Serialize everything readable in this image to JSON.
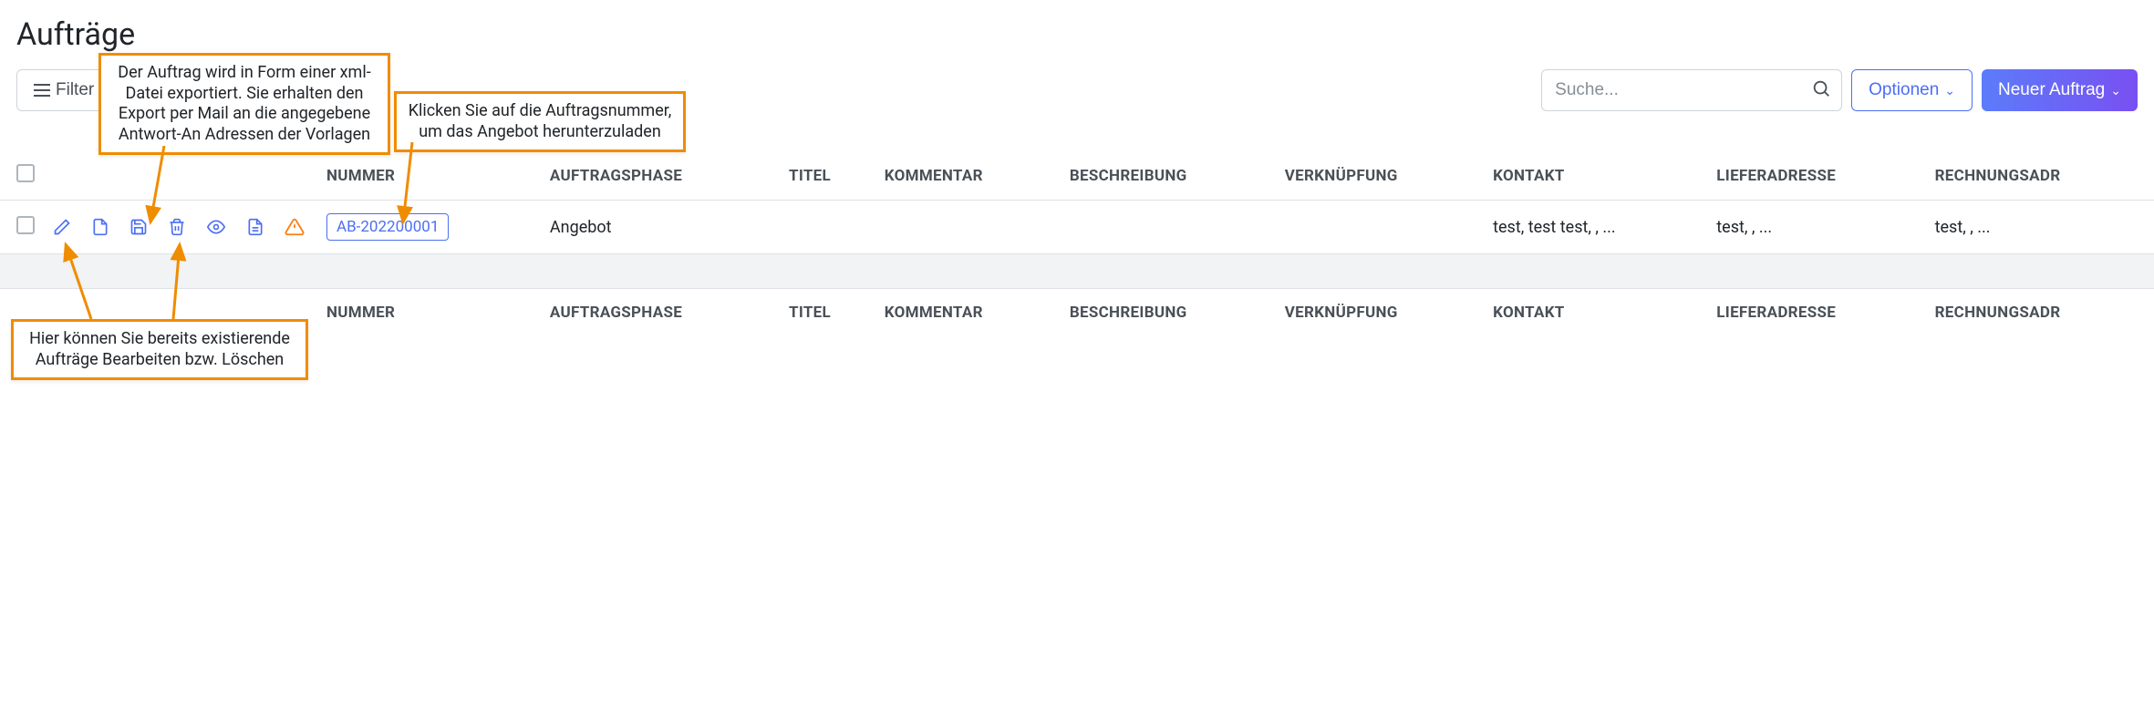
{
  "page": {
    "title": "Aufträge"
  },
  "toolbar": {
    "filter": "Filter",
    "search_placeholder": "Suche...",
    "options": "Optionen",
    "new_order": "Neuer Auftrag"
  },
  "columns": {
    "number": "NUMMER",
    "phase": "AUFTRAGSPHASE",
    "title": "TITEL",
    "comment": "KOMMENTAR",
    "description": "BESCHREIBUNG",
    "link": "VERKNÜPFUNG",
    "contact": "KONTAKT",
    "delivery": "LIEFERADRESSE",
    "billing": "RECHNUNGSADR"
  },
  "rows": [
    {
      "number": "AB-202200001",
      "phase": "Angebot",
      "title": "",
      "comment": "",
      "description": "",
      "link": "",
      "contact": "test, test test, , ...",
      "delivery": "test, , ...",
      "billing": "test, , ..."
    }
  ],
  "annotations": {
    "export": "Der Auftrag wird in Form einer xml-Datei exportiert. Sie erhalten den Export per Mail an die angegebene Antwort-An Adressen der Vorlagen",
    "download": "Klicken Sie auf die Auftragsnummer, um das Angebot herunterzuladen",
    "edit_delete": "Hier können Sie bereits existierende Aufträge Bearbeiten bzw. Löschen"
  }
}
